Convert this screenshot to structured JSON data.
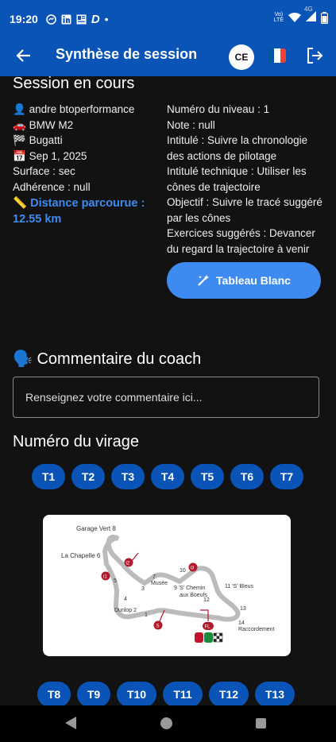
{
  "status_bar": {
    "time": "19:20",
    "left_icons": [
      "messenger-icon",
      "linkedin-icon",
      "news-icon",
      "dolby-icon",
      "dot-icon"
    ],
    "right_icons": [
      "volte-icon",
      "wifi-icon",
      "signal-4g-icon",
      "battery-icon"
    ],
    "network_label": "4G"
  },
  "app_bar": {
    "title": "Synthèse de session",
    "avatar_initials": "CE",
    "flag_colors": [
      "#0055A4",
      "#FFFFFF",
      "#EF4135"
    ]
  },
  "session": {
    "heading": "Session en cours",
    "user": "andre btoperformance",
    "car": "BMW M2",
    "circuit": "Bugatti",
    "date": "Sep 1, 2025",
    "surface": "Surface : sec",
    "adherence": "Adhérence : null",
    "distance_label": "Distance parcourue :",
    "distance_value": "12.55 km"
  },
  "details": {
    "level": "Numéro du niveau : 1",
    "note": "Note : null",
    "title": "Intitulé : Suivre la chronologie des actions de pilotage",
    "technical_title": "Intitulé technique : Utiliser les cônes de trajectoire",
    "objective": "Objectif : Suivre le tracé suggéré par les cônes",
    "exercises": "Exercices suggérés : Devancer du regard la trajectoire à venir"
  },
  "whiteboard_button": {
    "label": "Tableau Blanc"
  },
  "coach": {
    "heading": "Commentaire du coach",
    "placeholder": "Renseignez votre commentaire ici..."
  },
  "turns": {
    "heading": "Numéro du virage",
    "row1": [
      "T1",
      "T2",
      "T3",
      "T4",
      "T5",
      "T6",
      "T7"
    ],
    "row2": [
      "T8",
      "T9",
      "T10",
      "T11",
      "T12",
      "T13"
    ]
  },
  "track_map": {
    "labels": [
      "Garage Vert 8",
      "La Chapelle 6",
      "7",
      "Musée",
      "10",
      "9 'S' Chemin",
      "aux Boeufs",
      "11 'S' Bleus",
      "5",
      "3",
      "4",
      "Dunlop 2",
      "1",
      "12",
      "13",
      "14",
      "Raccordement"
    ],
    "markers": [
      "i2",
      "i1",
      "i3",
      "S",
      "FL"
    ]
  }
}
